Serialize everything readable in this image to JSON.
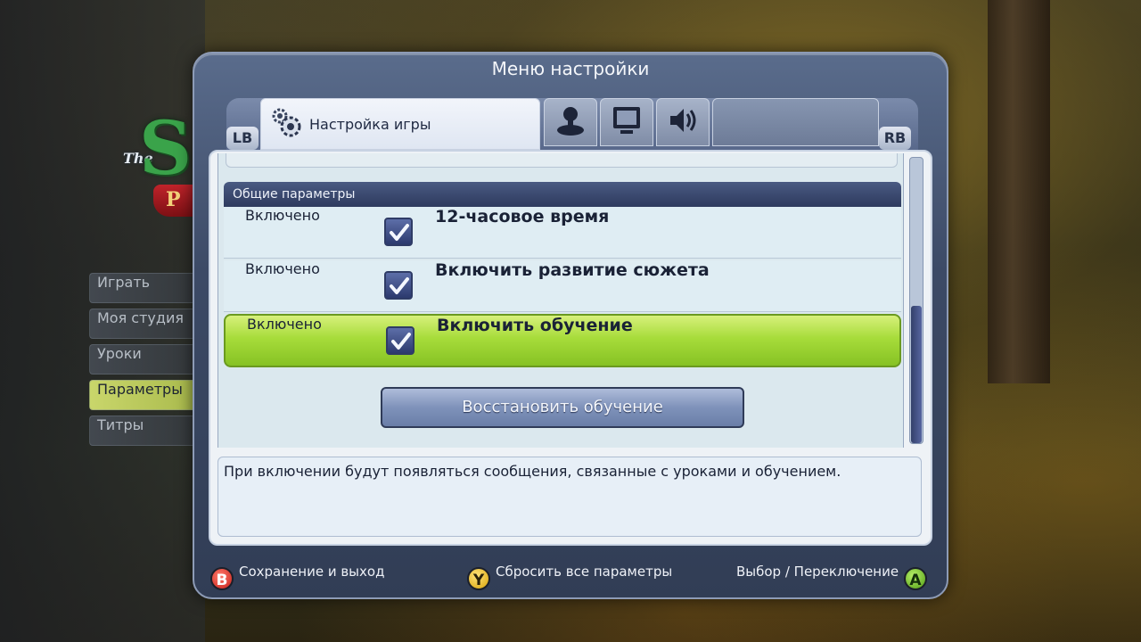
{
  "logo": {
    "the": "The",
    "s": "S",
    "ribbon": "P"
  },
  "main_menu": {
    "items": [
      {
        "label": "Играть"
      },
      {
        "label": "Моя студия"
      },
      {
        "label": "Уроки"
      },
      {
        "label": "Параметры",
        "active": true
      },
      {
        "label": "Титры"
      }
    ]
  },
  "dialog": {
    "title": "Меню настройки",
    "lb": "LB",
    "rb": "RB",
    "tabs": [
      {
        "label": "Настройка игры",
        "icon": "gears-icon",
        "active": true
      },
      {
        "icon": "joystick-icon"
      },
      {
        "icon": "monitor-icon"
      },
      {
        "icon": "speaker-icon"
      }
    ],
    "section_header": "Общие параметры",
    "options": [
      {
        "state": "Включено",
        "label": "12-часовое время",
        "checked": true
      },
      {
        "state": "Включено",
        "label": "Включить развитие сюжета",
        "checked": true
      },
      {
        "state": "Включено",
        "label": "Включить обучение",
        "checked": true,
        "highlighted": true
      }
    ],
    "restore_button": "Восстановить обучение",
    "description": "При включении будут появляться сообщения, связанные с уроками и обучением."
  },
  "footer": {
    "b_key": "B",
    "b_label": "Сохранение и выход",
    "y_key": "Y",
    "y_label": "Сбросить все параметры",
    "a_key": "A",
    "a_label": "Выбор / Переключение"
  },
  "colors": {
    "highlight": "#a7dc3a",
    "section_header": "#2e3a5e",
    "dialog_frame": "#3c4a66"
  }
}
